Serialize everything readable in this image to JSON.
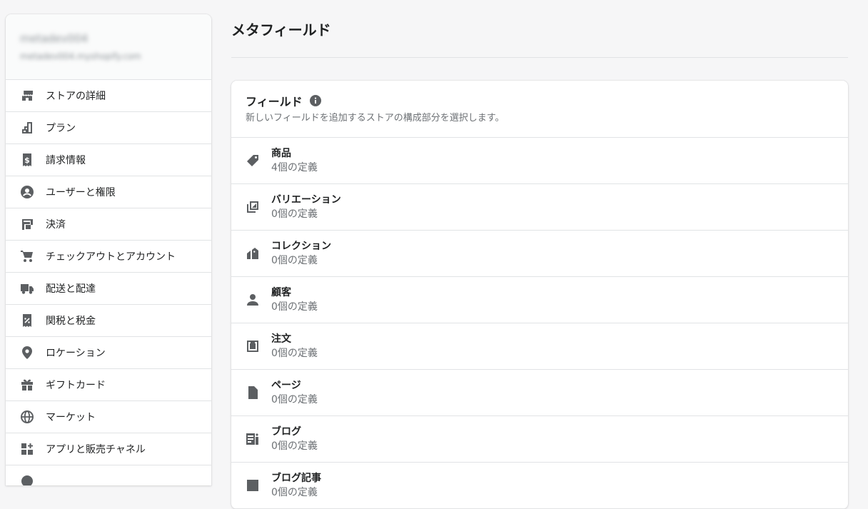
{
  "store": {
    "name": "metadev004",
    "url": "metadev004.myshopify.com"
  },
  "sidebar": {
    "items": [
      {
        "label": "ストアの詳細",
        "icon": "store-icon"
      },
      {
        "label": "プラン",
        "icon": "plan-icon"
      },
      {
        "label": "請求情報",
        "icon": "billing-icon"
      },
      {
        "label": "ユーザーと権限",
        "icon": "user-icon"
      },
      {
        "label": "決済",
        "icon": "payments-icon"
      },
      {
        "label": "チェックアウトとアカウント",
        "icon": "cart-icon"
      },
      {
        "label": "配送と配達",
        "icon": "truck-icon"
      },
      {
        "label": "関税と税金",
        "icon": "tax-icon"
      },
      {
        "label": "ロケーション",
        "icon": "location-pin-icon"
      },
      {
        "label": "ギフトカード",
        "icon": "gift-icon"
      },
      {
        "label": "マーケット",
        "icon": "globe-icon"
      },
      {
        "label": "アプリと販売チャネル",
        "icon": "apps-icon"
      }
    ]
  },
  "main": {
    "title": "メタフィールド",
    "card": {
      "title": "フィールド",
      "subtitle": "新しいフィールドを追加するストアの構成部分を選択します。",
      "rows": [
        {
          "title": "商品",
          "count": "4個の定義",
          "icon": "tag-icon"
        },
        {
          "title": "バリエーション",
          "count": "0個の定義",
          "icon": "variant-icon"
        },
        {
          "title": "コレクション",
          "count": "0個の定義",
          "icon": "collection-icon"
        },
        {
          "title": "顧客",
          "count": "0個の定義",
          "icon": "customer-icon"
        },
        {
          "title": "注文",
          "count": "0個の定義",
          "icon": "order-icon"
        },
        {
          "title": "ページ",
          "count": "0個の定義",
          "icon": "page-icon"
        },
        {
          "title": "ブログ",
          "count": "0個の定義",
          "icon": "blog-icon"
        },
        {
          "title": "ブログ記事",
          "count": "0個の定義",
          "icon": "blog-post-icon"
        }
      ]
    }
  },
  "colors": {
    "background": "#f6f6f7",
    "icon": "#5c5f62",
    "text": "#202223",
    "subdued": "#6d7175",
    "border": "#e1e3e5"
  }
}
